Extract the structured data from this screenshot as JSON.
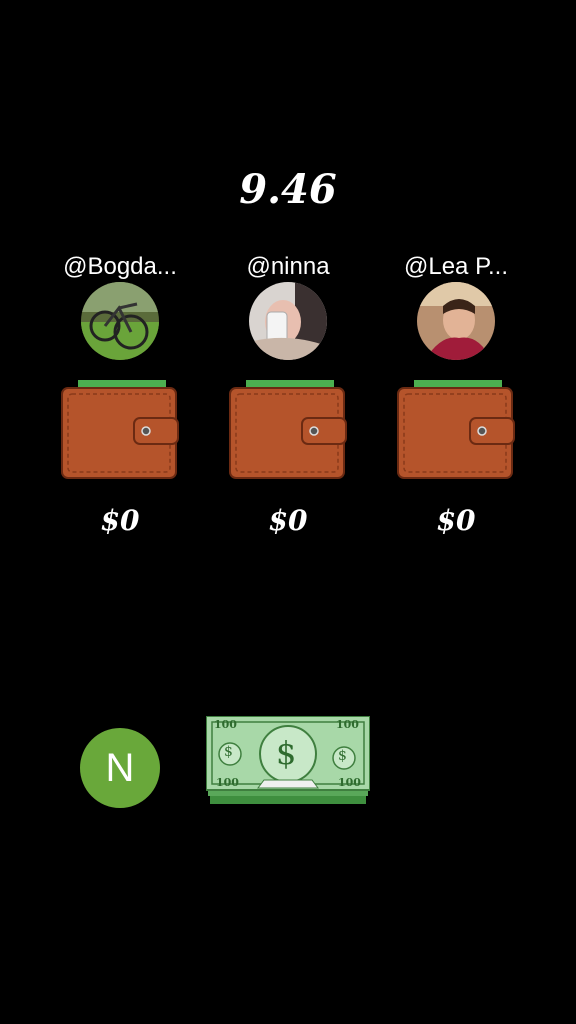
{
  "timer": "9.46",
  "players": [
    {
      "handle": "@Bogda...",
      "amount": "$0",
      "avatar": "bicycle-photo"
    },
    {
      "handle": "@ninna",
      "amount": "$0",
      "avatar": "selfie-photo"
    },
    {
      "handle": "@Lea P...",
      "amount": "$0",
      "avatar": "portrait-photo"
    }
  ],
  "current_user": {
    "initial": "N",
    "color": "#69a83a"
  },
  "bill": {
    "denomination": "100",
    "symbol": "$"
  },
  "colors": {
    "wallet": "#b5542b",
    "wallet_dark": "#8a3a1a",
    "bill": "#9ad19a"
  }
}
